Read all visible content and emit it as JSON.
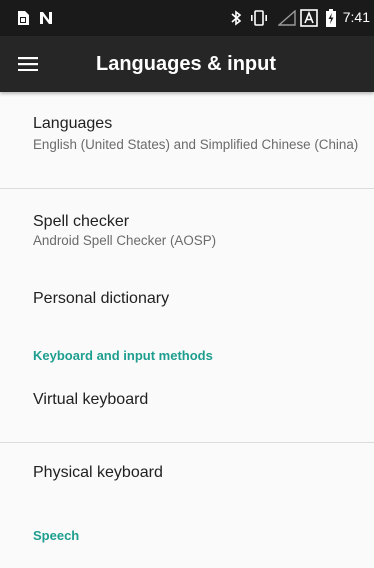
{
  "status_bar": {
    "time": "7:41",
    "icons": [
      "sim-card-icon",
      "n-icon",
      "bluetooth-icon",
      "vibrate-icon",
      "signal-icon",
      "a-box-icon",
      "battery-charging-icon"
    ]
  },
  "app_bar": {
    "menu_icon": "hamburger-menu-icon",
    "title": "Languages & input"
  },
  "items": [
    {
      "title": "Languages",
      "summary": "English (United States) and Simplified Chinese (China)"
    },
    {
      "title": "Spell checker",
      "summary": "Android Spell Checker (AOSP)"
    },
    {
      "title": "Personal dictionary"
    },
    {
      "title": "Virtual keyboard"
    },
    {
      "title": "Physical keyboard"
    }
  ],
  "sections": {
    "keyboard": "Keyboard and input methods",
    "speech": "Speech"
  },
  "colors": {
    "status_bar": "#1a1a1a",
    "app_bar": "#262626",
    "accent": "#1e9e8f",
    "background": "#fafafa"
  }
}
